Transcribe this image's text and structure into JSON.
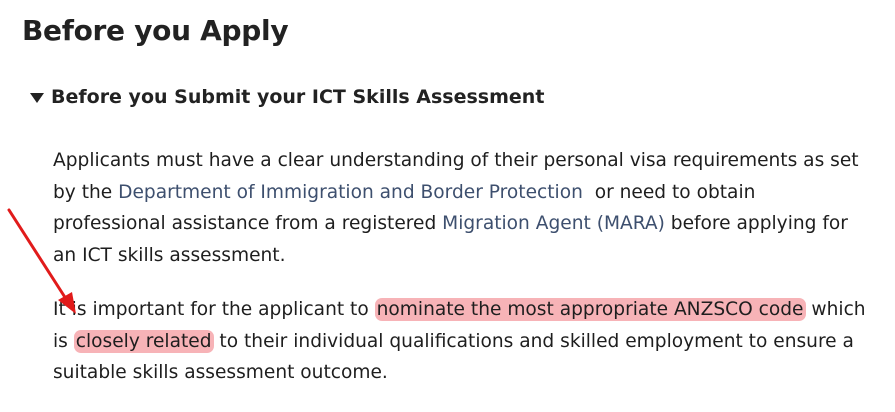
{
  "page": {
    "title": "Before you Apply"
  },
  "accordion": {
    "header": "Before you Submit your ICT Skills Assessment",
    "expanded": true
  },
  "paragraph1": {
    "line1": "Applicants must have a clear understanding of their personal visa requirements as set",
    "line2_prefix": "by the ",
    "link_department": "Department of Immigration and Border Protection",
    "line2_suffix": "  or need to obtain",
    "line3_prefix": "professional assistance from a registered ",
    "link_migration_agent": "Migration Agent (MARA)",
    "line3_suffix": " before applying for",
    "line4": "an ICT skills assessment."
  },
  "paragraph2": {
    "line1_prefix": "It is important for the applicant to ",
    "highlight1": "nominate the most appropriate ANZSCO code",
    "line1_suffix": " which",
    "line2_prefix": "is ",
    "highlight2": "closely related",
    "line2_suffix": " to their individual qualifications and skilled employment to ensure a",
    "line3": "suitable skills assessment outcome."
  },
  "colors": {
    "link": "#3d4f6e",
    "highlight": "#f4969b",
    "annotation_arrow": "#e11b1b",
    "text": "#1e1e1e"
  },
  "icons": {
    "accordion_caret": "caret-down-icon",
    "annotation": "red-arrow-annotation"
  }
}
